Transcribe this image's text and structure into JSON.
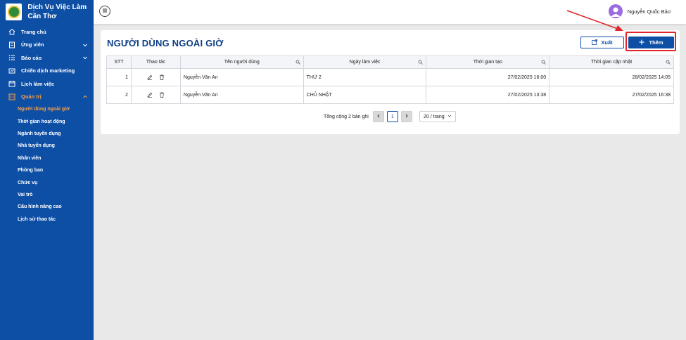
{
  "brand": {
    "name": "Dịch Vụ Việc Làm Cần Thơ"
  },
  "sidebar": {
    "items": [
      {
        "label": "Trang chủ",
        "icon": "home-icon",
        "chevron": ""
      },
      {
        "label": "Ứng viên",
        "icon": "candidate-icon",
        "chevron": "down"
      },
      {
        "label": "Báo cáo",
        "icon": "list-icon",
        "chevron": "down"
      },
      {
        "label": "Chiến dịch marketing",
        "icon": "campaign-icon",
        "chevron": ""
      },
      {
        "label": "Lịch làm việc",
        "icon": "calendar-icon",
        "chevron": ""
      },
      {
        "label": "Quản trị",
        "icon": "admin-icon",
        "chevron": "up"
      }
    ],
    "sub_items": [
      "Người dùng ngoài giờ",
      "Thời gian hoạt động",
      "Ngành tuyển dụng",
      "Nhà tuyển dụng",
      "Nhân viên",
      "Phòng ban",
      "Chức vụ",
      "Vai trò",
      "Cấu hình nâng cao",
      "Lịch sử thao tác"
    ],
    "active_sub": "Người dùng ngoài giờ"
  },
  "header": {
    "user_name": "Nguyễn Quốc Bảo"
  },
  "page": {
    "title": "NGƯỜI DÙNG NGOÀI GIỜ",
    "export_label": "Xuất",
    "add_label": "Thêm"
  },
  "table": {
    "columns": [
      "STT",
      "Thao tác",
      "Tên người dùng",
      "Ngày làm việc",
      "Thời gian tạo",
      "Thời gian cập nhật"
    ],
    "rows": [
      {
        "stt": "1",
        "name": "Nguyễn Văn An",
        "day": "THỨ 2",
        "created": "27/02/2025 16:00",
        "updated": "28/02/2025 14:05"
      },
      {
        "stt": "2",
        "name": "Nguyễn Văn An",
        "day": "CHỦ NHẬT",
        "created": "27/02/2025 13:38",
        "updated": "27/02/2025 16:38"
      }
    ]
  },
  "pagination": {
    "total_text": "Tổng cộng 2 bản ghi",
    "current_page": "1",
    "page_size": "20 / trang"
  },
  "colors": {
    "sidebar_bg": "#0e4fa6",
    "active_text": "#ff9f43",
    "primary": "#0e4fa6",
    "annotation": "#e0262b"
  }
}
